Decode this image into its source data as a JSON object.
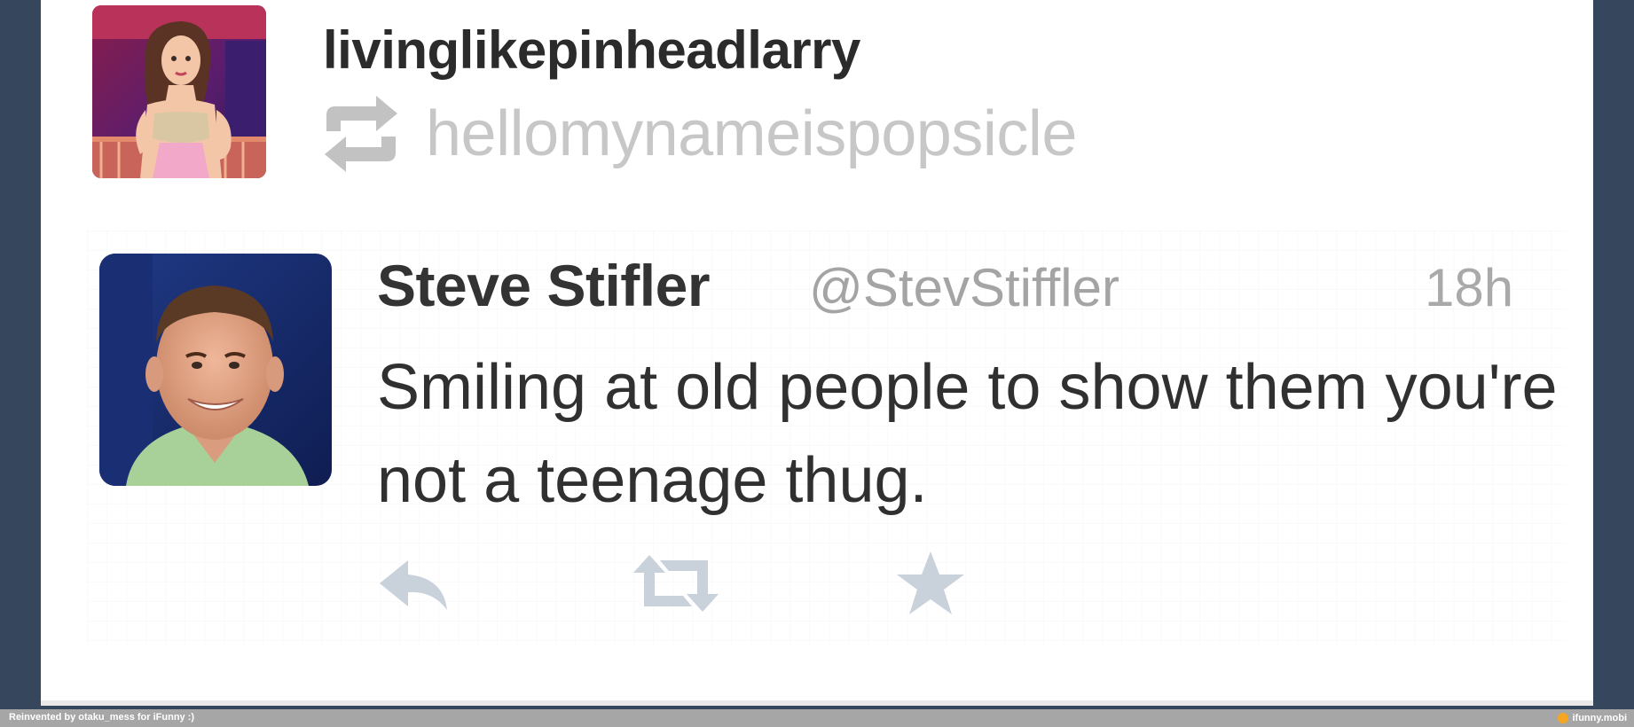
{
  "post": {
    "author_username": "livinglikepinheadlarry",
    "reblogged_from": "hellomynameispopsicle",
    "reblog_icon": "reblog-icon"
  },
  "tweet": {
    "display_name": "Steve Stifler",
    "handle": "@StevStiffler",
    "time": "18h",
    "text": "Smiling at old people to show them you're not a teenage thug.",
    "actions": [
      {
        "name": "reply",
        "icon": "reply-icon"
      },
      {
        "name": "retweet",
        "icon": "retweet-icon"
      },
      {
        "name": "favorite",
        "icon": "star-icon"
      }
    ]
  },
  "footer": {
    "credit": "Reinvented by otaku_mess for iFunny :)",
    "site": "ifunny.mobi"
  },
  "colors": {
    "background": "#36465d",
    "card": "#ffffff",
    "muted_text": "#c7c7c7",
    "action_icons": "#c9d1da",
    "footer_bar": "#a6a6a6"
  }
}
